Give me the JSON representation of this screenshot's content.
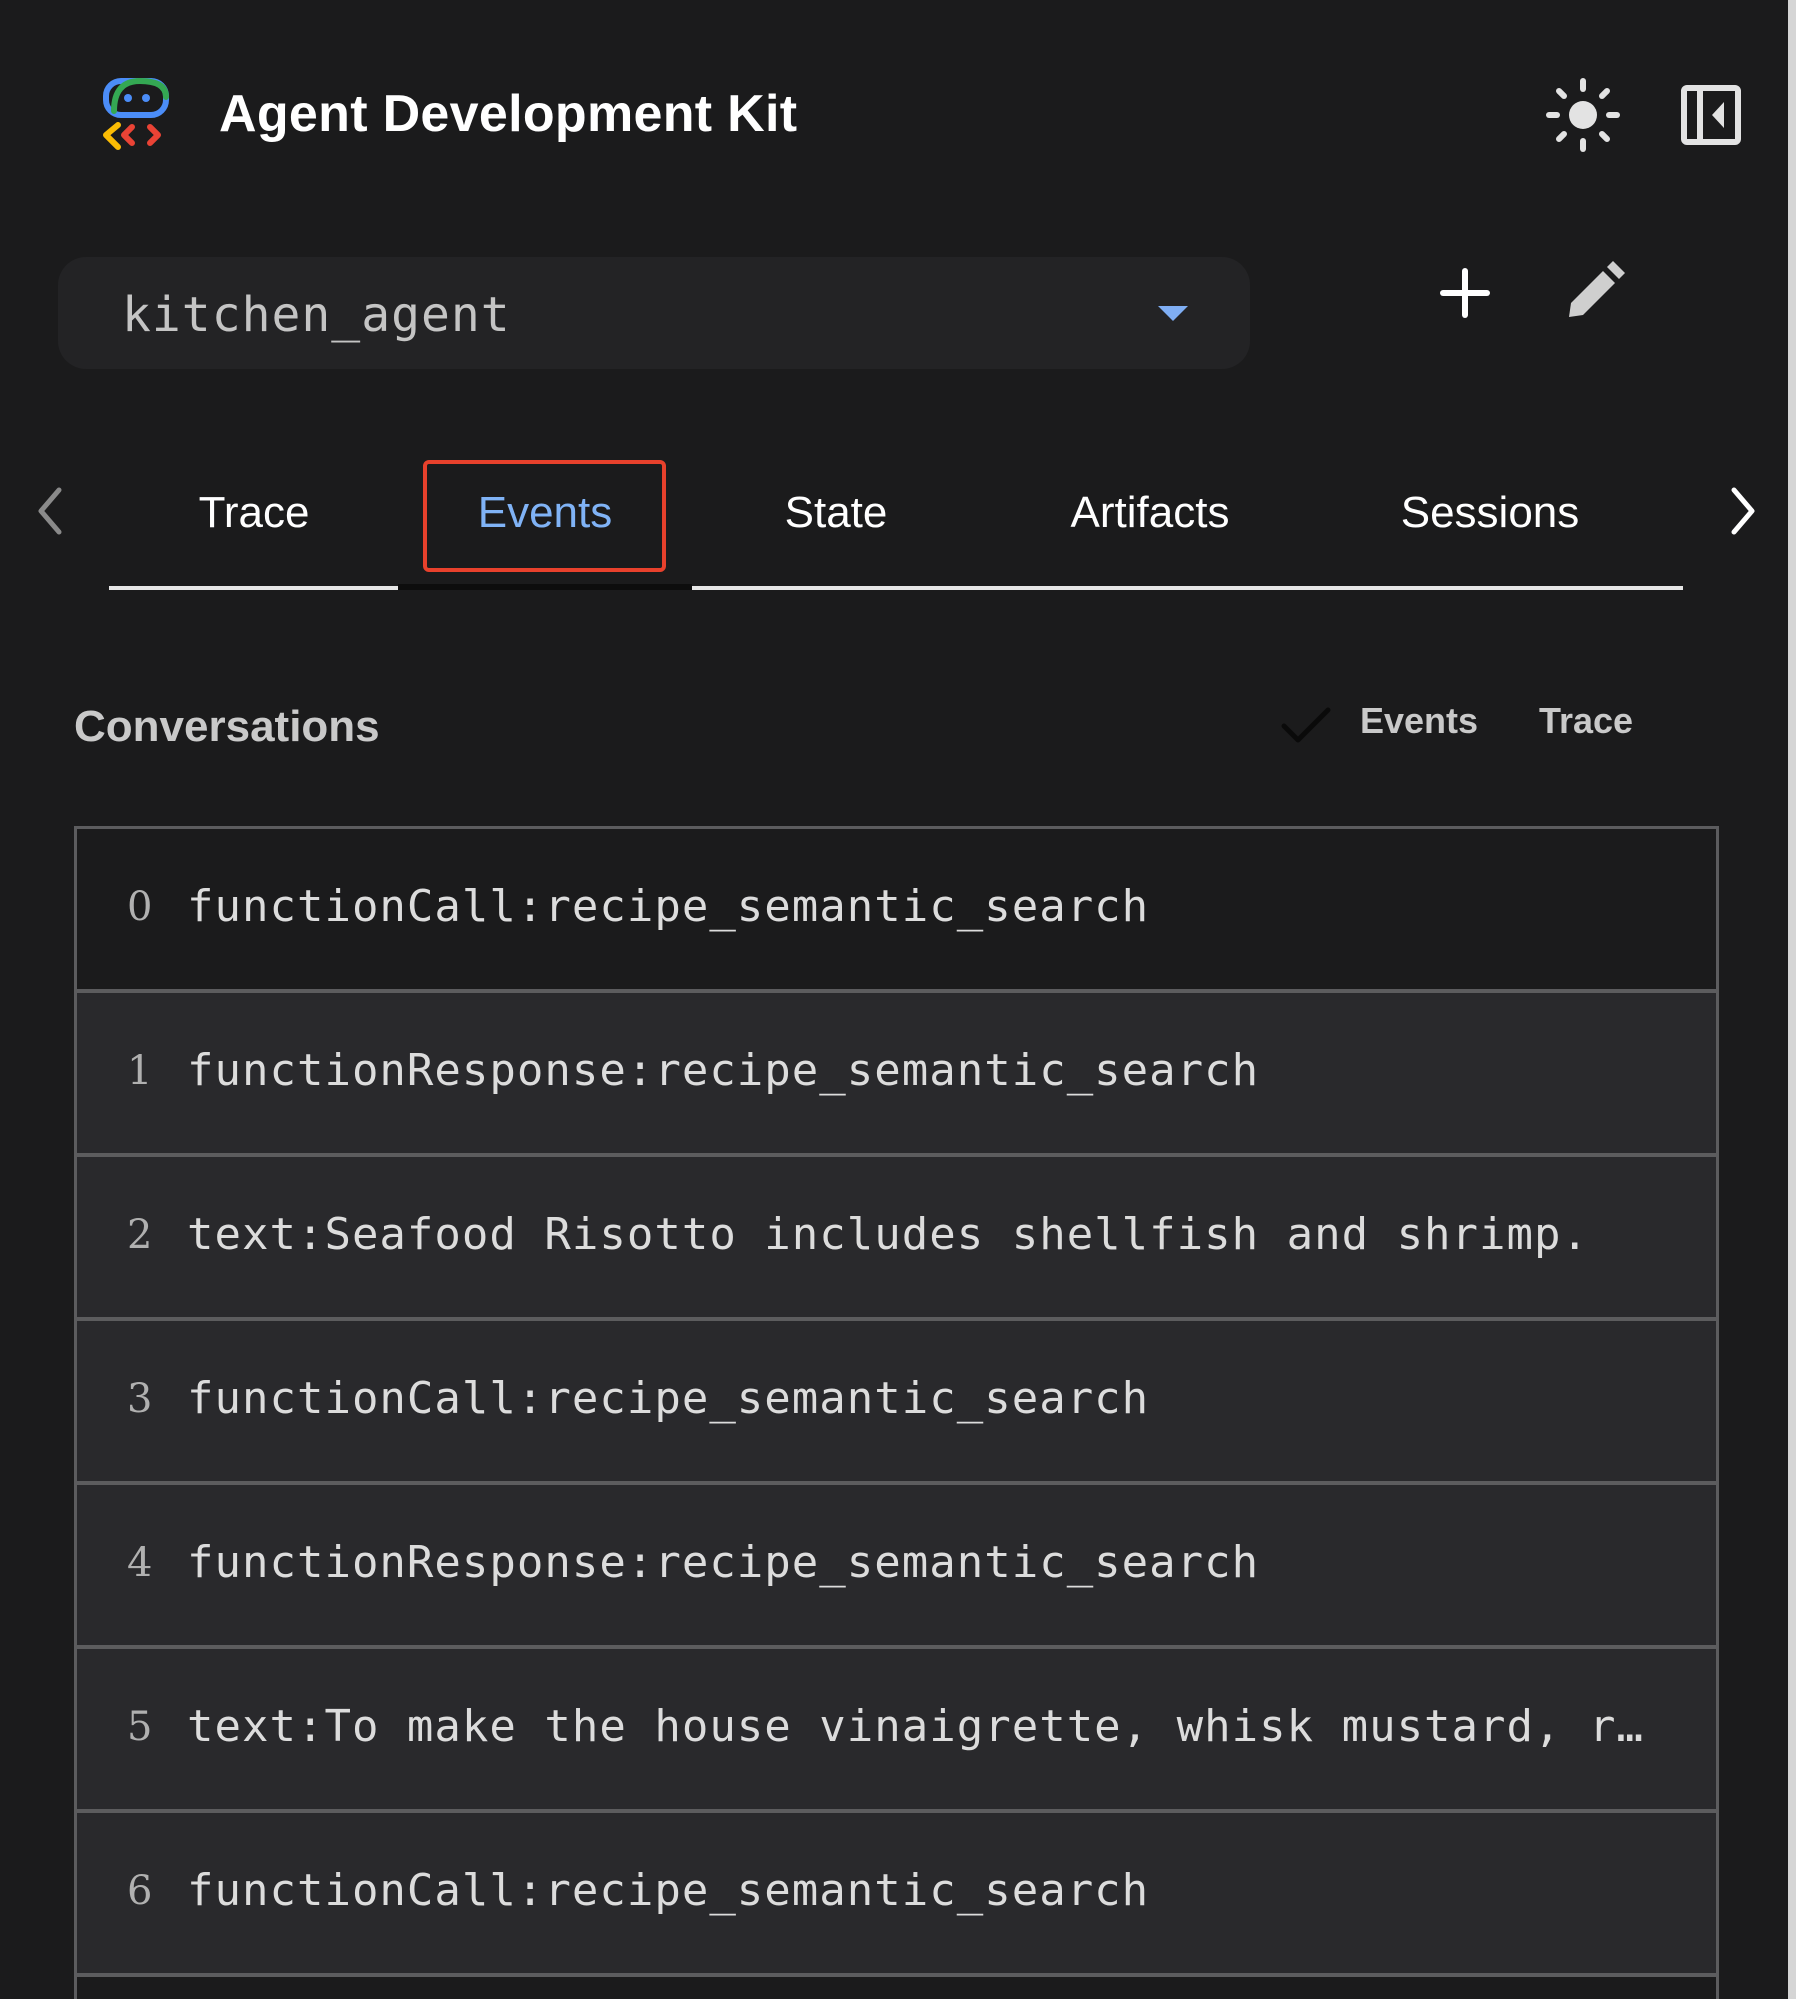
{
  "header": {
    "title": "Agent Development Kit",
    "theme_icon": "sun-icon",
    "panel_icon": "collapse-panel-icon"
  },
  "agent_selector": {
    "selected": "kitchen_agent",
    "dropdown_icon": "caret-down-icon"
  },
  "agent_actions": {
    "add_icon": "plus-icon",
    "edit_icon": "pencil-icon"
  },
  "tabs": [
    {
      "label": "Trace",
      "active": false
    },
    {
      "label": "Events",
      "active": true
    },
    {
      "label": "State",
      "active": false
    },
    {
      "label": "Artifacts",
      "active": false
    },
    {
      "label": "Sessions",
      "active": false
    }
  ],
  "conversations": {
    "title": "Conversations",
    "toggle": {
      "options": [
        "Events",
        "Trace"
      ],
      "selected": "Events"
    },
    "events": [
      {
        "index": "0",
        "text": "functionCall:recipe_semantic_search"
      },
      {
        "index": "1",
        "text": "functionResponse:recipe_semantic_search"
      },
      {
        "index": "2",
        "text": "text:Seafood Risotto includes shellfish and shrimp."
      },
      {
        "index": "3",
        "text": "functionCall:recipe_semantic_search"
      },
      {
        "index": "4",
        "text": "functionResponse:recipe_semantic_search"
      },
      {
        "index": "5",
        "text": "text:To make the house vinaigrette, whisk mustard, re…"
      },
      {
        "index": "6",
        "text": "functionCall:recipe_semantic_search"
      }
    ]
  },
  "colors": {
    "background": "#1b1b1c",
    "active_tab": "#80b3f6",
    "highlight_box": "#e8412c",
    "row_background": "#29292c",
    "row_border": "#5c5c5e"
  }
}
